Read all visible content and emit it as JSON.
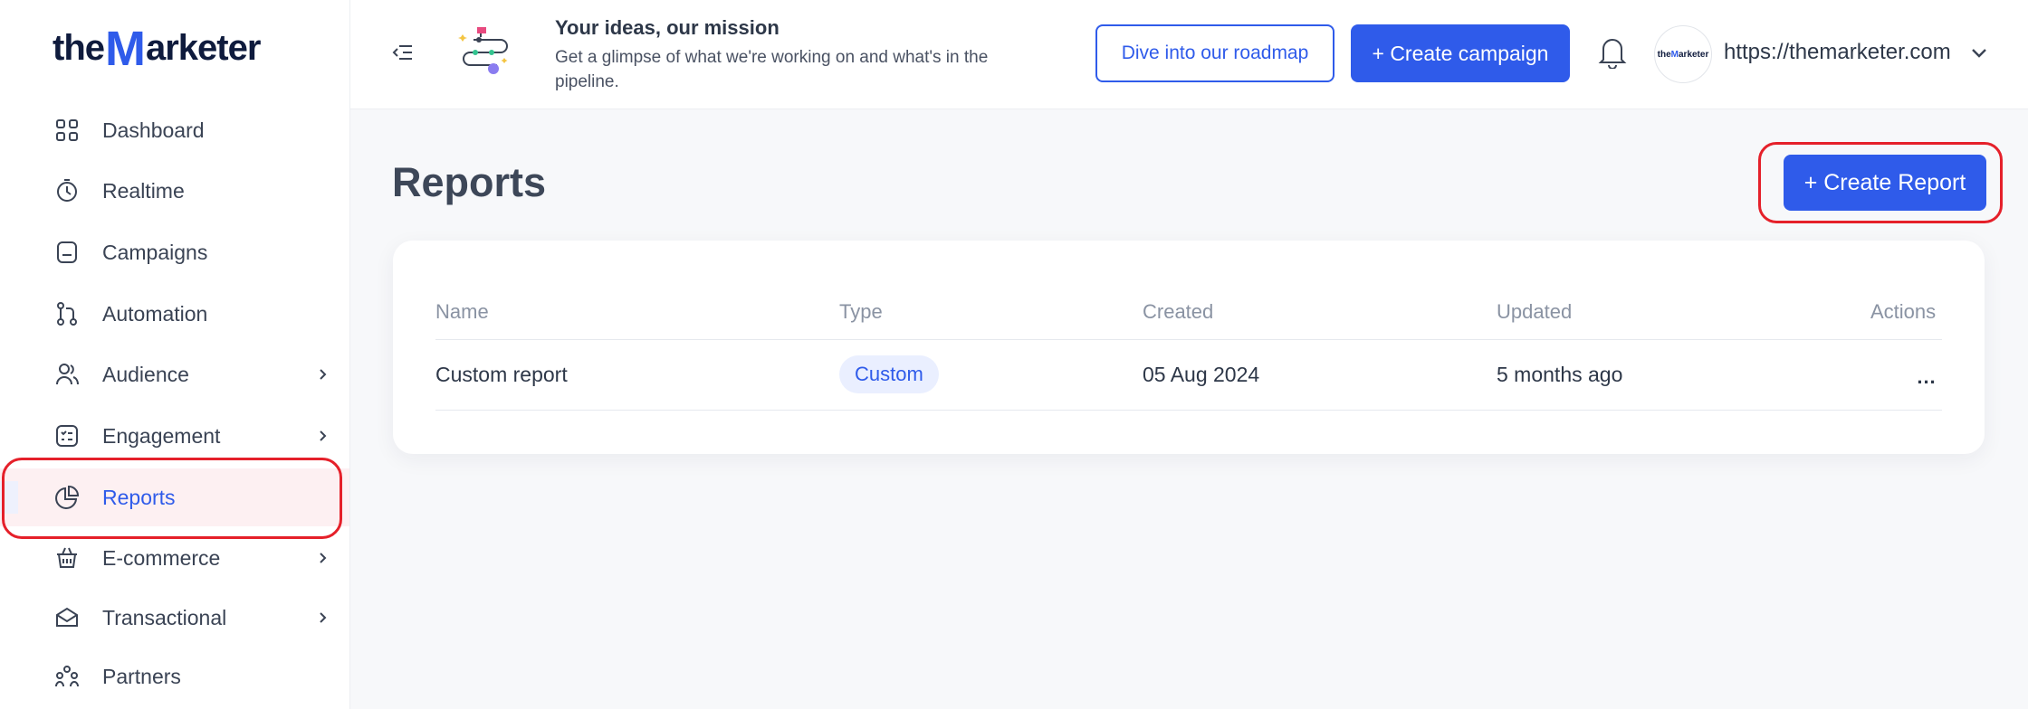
{
  "brand": {
    "logo_left": "the",
    "logo_mark": "M",
    "logo_right": "arketer",
    "accent_color": "#2f5bea"
  },
  "sidebar": {
    "items": [
      {
        "label": "Dashboard",
        "icon": "grid-icon",
        "has_submenu": false
      },
      {
        "label": "Realtime",
        "icon": "timer-icon",
        "has_submenu": false
      },
      {
        "label": "Campaigns",
        "icon": "campaign-icon",
        "has_submenu": false
      },
      {
        "label": "Automation",
        "icon": "workflow-icon",
        "has_submenu": false
      },
      {
        "label": "Audience",
        "icon": "users-icon",
        "has_submenu": true
      },
      {
        "label": "Engagement",
        "icon": "checklist-icon",
        "has_submenu": true
      },
      {
        "label": "Reports",
        "icon": "pie-chart-icon",
        "has_submenu": false,
        "active": true
      },
      {
        "label": "E-commerce",
        "icon": "basket-icon",
        "has_submenu": true
      },
      {
        "label": "Transactional",
        "icon": "envelope-icon",
        "has_submenu": true
      },
      {
        "label": "Partners",
        "icon": "partners-icon",
        "has_submenu": false
      }
    ]
  },
  "header": {
    "promo_title": "Your ideas, our mission",
    "promo_text": "Get a glimpse of what we're working on and what's in the pipeline.",
    "roadmap_label": "Dive into our roadmap",
    "create_campaign_label": "+ Create campaign",
    "account_url": "https://themarketer.com",
    "avatar_small_left": "the",
    "avatar_small_mark": "M",
    "avatar_small_right": "arketer"
  },
  "main": {
    "title": "Reports",
    "create_report_label": "+ Create Report",
    "table": {
      "columns": [
        "Name",
        "Type",
        "Created",
        "Updated",
        "Actions"
      ],
      "rows": [
        {
          "name": "Custom report",
          "type": "Custom",
          "created": "05 Aug 2024",
          "updated": "5 months ago",
          "actions": "..."
        }
      ]
    }
  }
}
